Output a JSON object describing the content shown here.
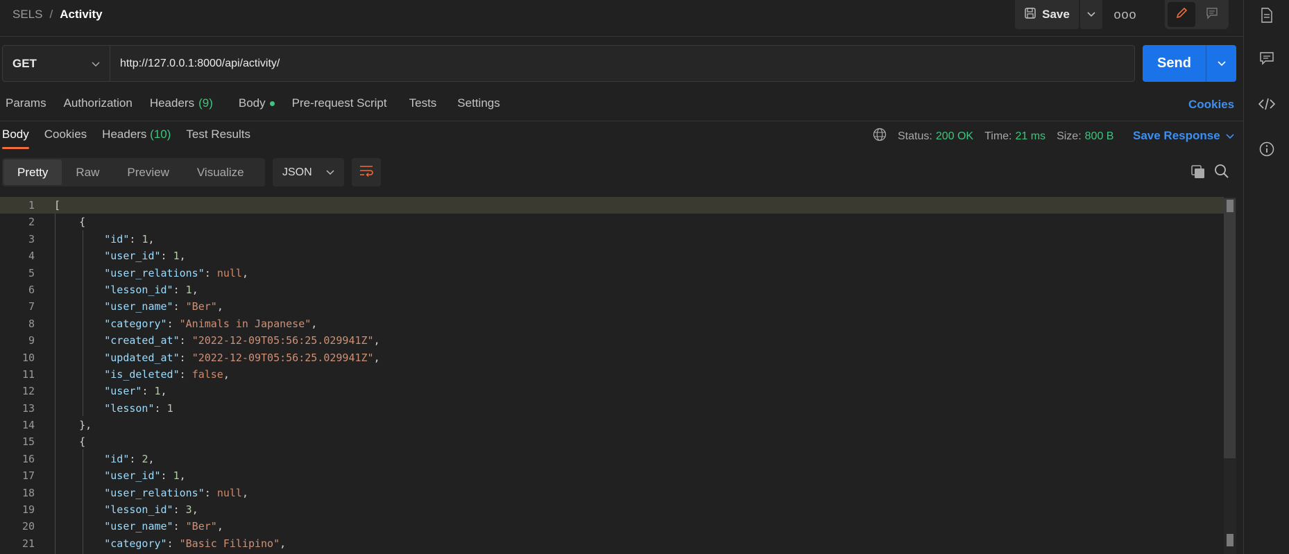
{
  "header": {
    "breadcrumb_parent": "SELS",
    "breadcrumb_sep": "/",
    "breadcrumb_current": "Activity",
    "save_label": "Save",
    "more_label": "ooo"
  },
  "request": {
    "method": "GET",
    "url": "http://127.0.0.1:8000/api/activity/",
    "send_label": "Send"
  },
  "request_tabs": {
    "params": "Params",
    "authorization": "Authorization",
    "headers": "Headers",
    "headers_count": "(9)",
    "body": "Body",
    "prerequest": "Pre-request Script",
    "tests": "Tests",
    "settings": "Settings",
    "cookies": "Cookies"
  },
  "response_tabs": {
    "body": "Body",
    "cookies": "Cookies",
    "headers": "Headers",
    "headers_count": "(10)",
    "test_results": "Test Results"
  },
  "response_meta": {
    "status_label": "Status:",
    "status_value": "200 OK",
    "time_label": "Time:",
    "time_value": "21 ms",
    "size_label": "Size:",
    "size_value": "800 B",
    "save_response": "Save Response"
  },
  "format": {
    "pretty": "Pretty",
    "raw": "Raw",
    "preview": "Preview",
    "visualize": "Visualize",
    "language": "JSON"
  },
  "colors": {
    "accent_blue": "#1a73e8",
    "status_green": "#3fc57d",
    "active_tab": "#f26b3a"
  },
  "code_lines": [
    {
      "n": "1"
    },
    {
      "n": "2"
    },
    {
      "n": "3"
    },
    {
      "n": "4"
    },
    {
      "n": "5"
    },
    {
      "n": "6"
    },
    {
      "n": "7"
    },
    {
      "n": "8"
    },
    {
      "n": "9"
    },
    {
      "n": "10"
    },
    {
      "n": "11"
    },
    {
      "n": "12"
    },
    {
      "n": "13"
    },
    {
      "n": "14"
    },
    {
      "n": "15"
    },
    {
      "n": "16"
    },
    {
      "n": "17"
    },
    {
      "n": "18"
    },
    {
      "n": "19"
    },
    {
      "n": "20"
    },
    {
      "n": "21"
    }
  ],
  "json": {
    "k_id": "\"id\"",
    "k_user_id": "\"user_id\"",
    "k_user_relations": "\"user_relations\"",
    "k_lesson_id": "\"lesson_id\"",
    "k_user_name": "\"user_name\"",
    "k_category": "\"category\"",
    "k_created_at": "\"created_at\"",
    "k_updated_at": "\"updated_at\"",
    "k_is_deleted": "\"is_deleted\"",
    "k_user": "\"user\"",
    "k_lesson": "\"lesson\"",
    "r1_id": "1",
    "r1_user_id": "1",
    "r1_user_relations": "null",
    "r1_lesson_id": "1",
    "r1_user_name": "\"Ber\"",
    "r1_category": "\"Animals in Japanese\"",
    "r1_created_at": "\"2022-12-09T05:56:25.029941Z\"",
    "r1_updated_at": "\"2022-12-09T05:56:25.029941Z\"",
    "r1_is_deleted": "false",
    "r1_user": "1",
    "r1_lesson": "1",
    "r2_id": "2",
    "r2_user_id": "1",
    "r2_user_relations": "null",
    "r2_lesson_id": "3",
    "r2_user_name": "\"Ber\"",
    "r2_category": "\"Basic Filipino\""
  }
}
